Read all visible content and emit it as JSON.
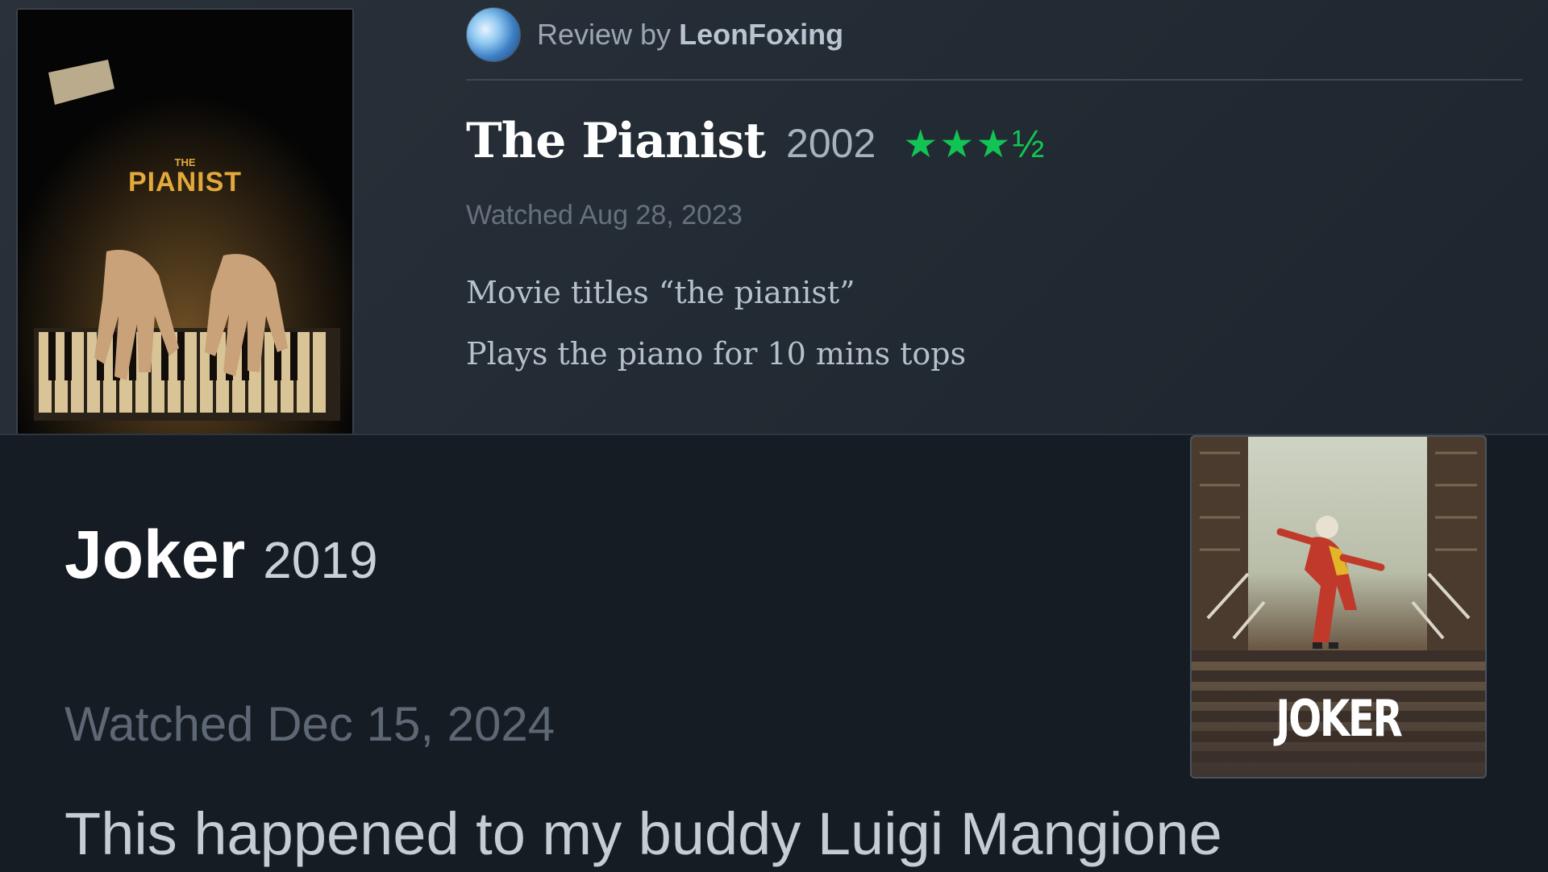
{
  "pianist_review": {
    "reviewer_prefix": "Review by",
    "reviewer_name": "LeonFoxing",
    "film_title": "The Pianist",
    "film_year": "2002",
    "rating": 3.5,
    "rating_stars": "★★★½",
    "watched": "Watched Aug 28, 2023",
    "review_lines": [
      "Movie titles “the pianist”",
      "Plays the piano for 10 mins tops"
    ],
    "poster_title_small": "THE",
    "poster_title": "PIANIST"
  },
  "joker_entry": {
    "film_title": "Joker",
    "film_year": "2019",
    "watched": "Watched Dec 15, 2024",
    "review_text": "This happened to my buddy Luigi Mangione",
    "poster_title": "JOKER"
  },
  "colors": {
    "star_green": "#11c454",
    "pianist_gold": "#e3a93a"
  }
}
